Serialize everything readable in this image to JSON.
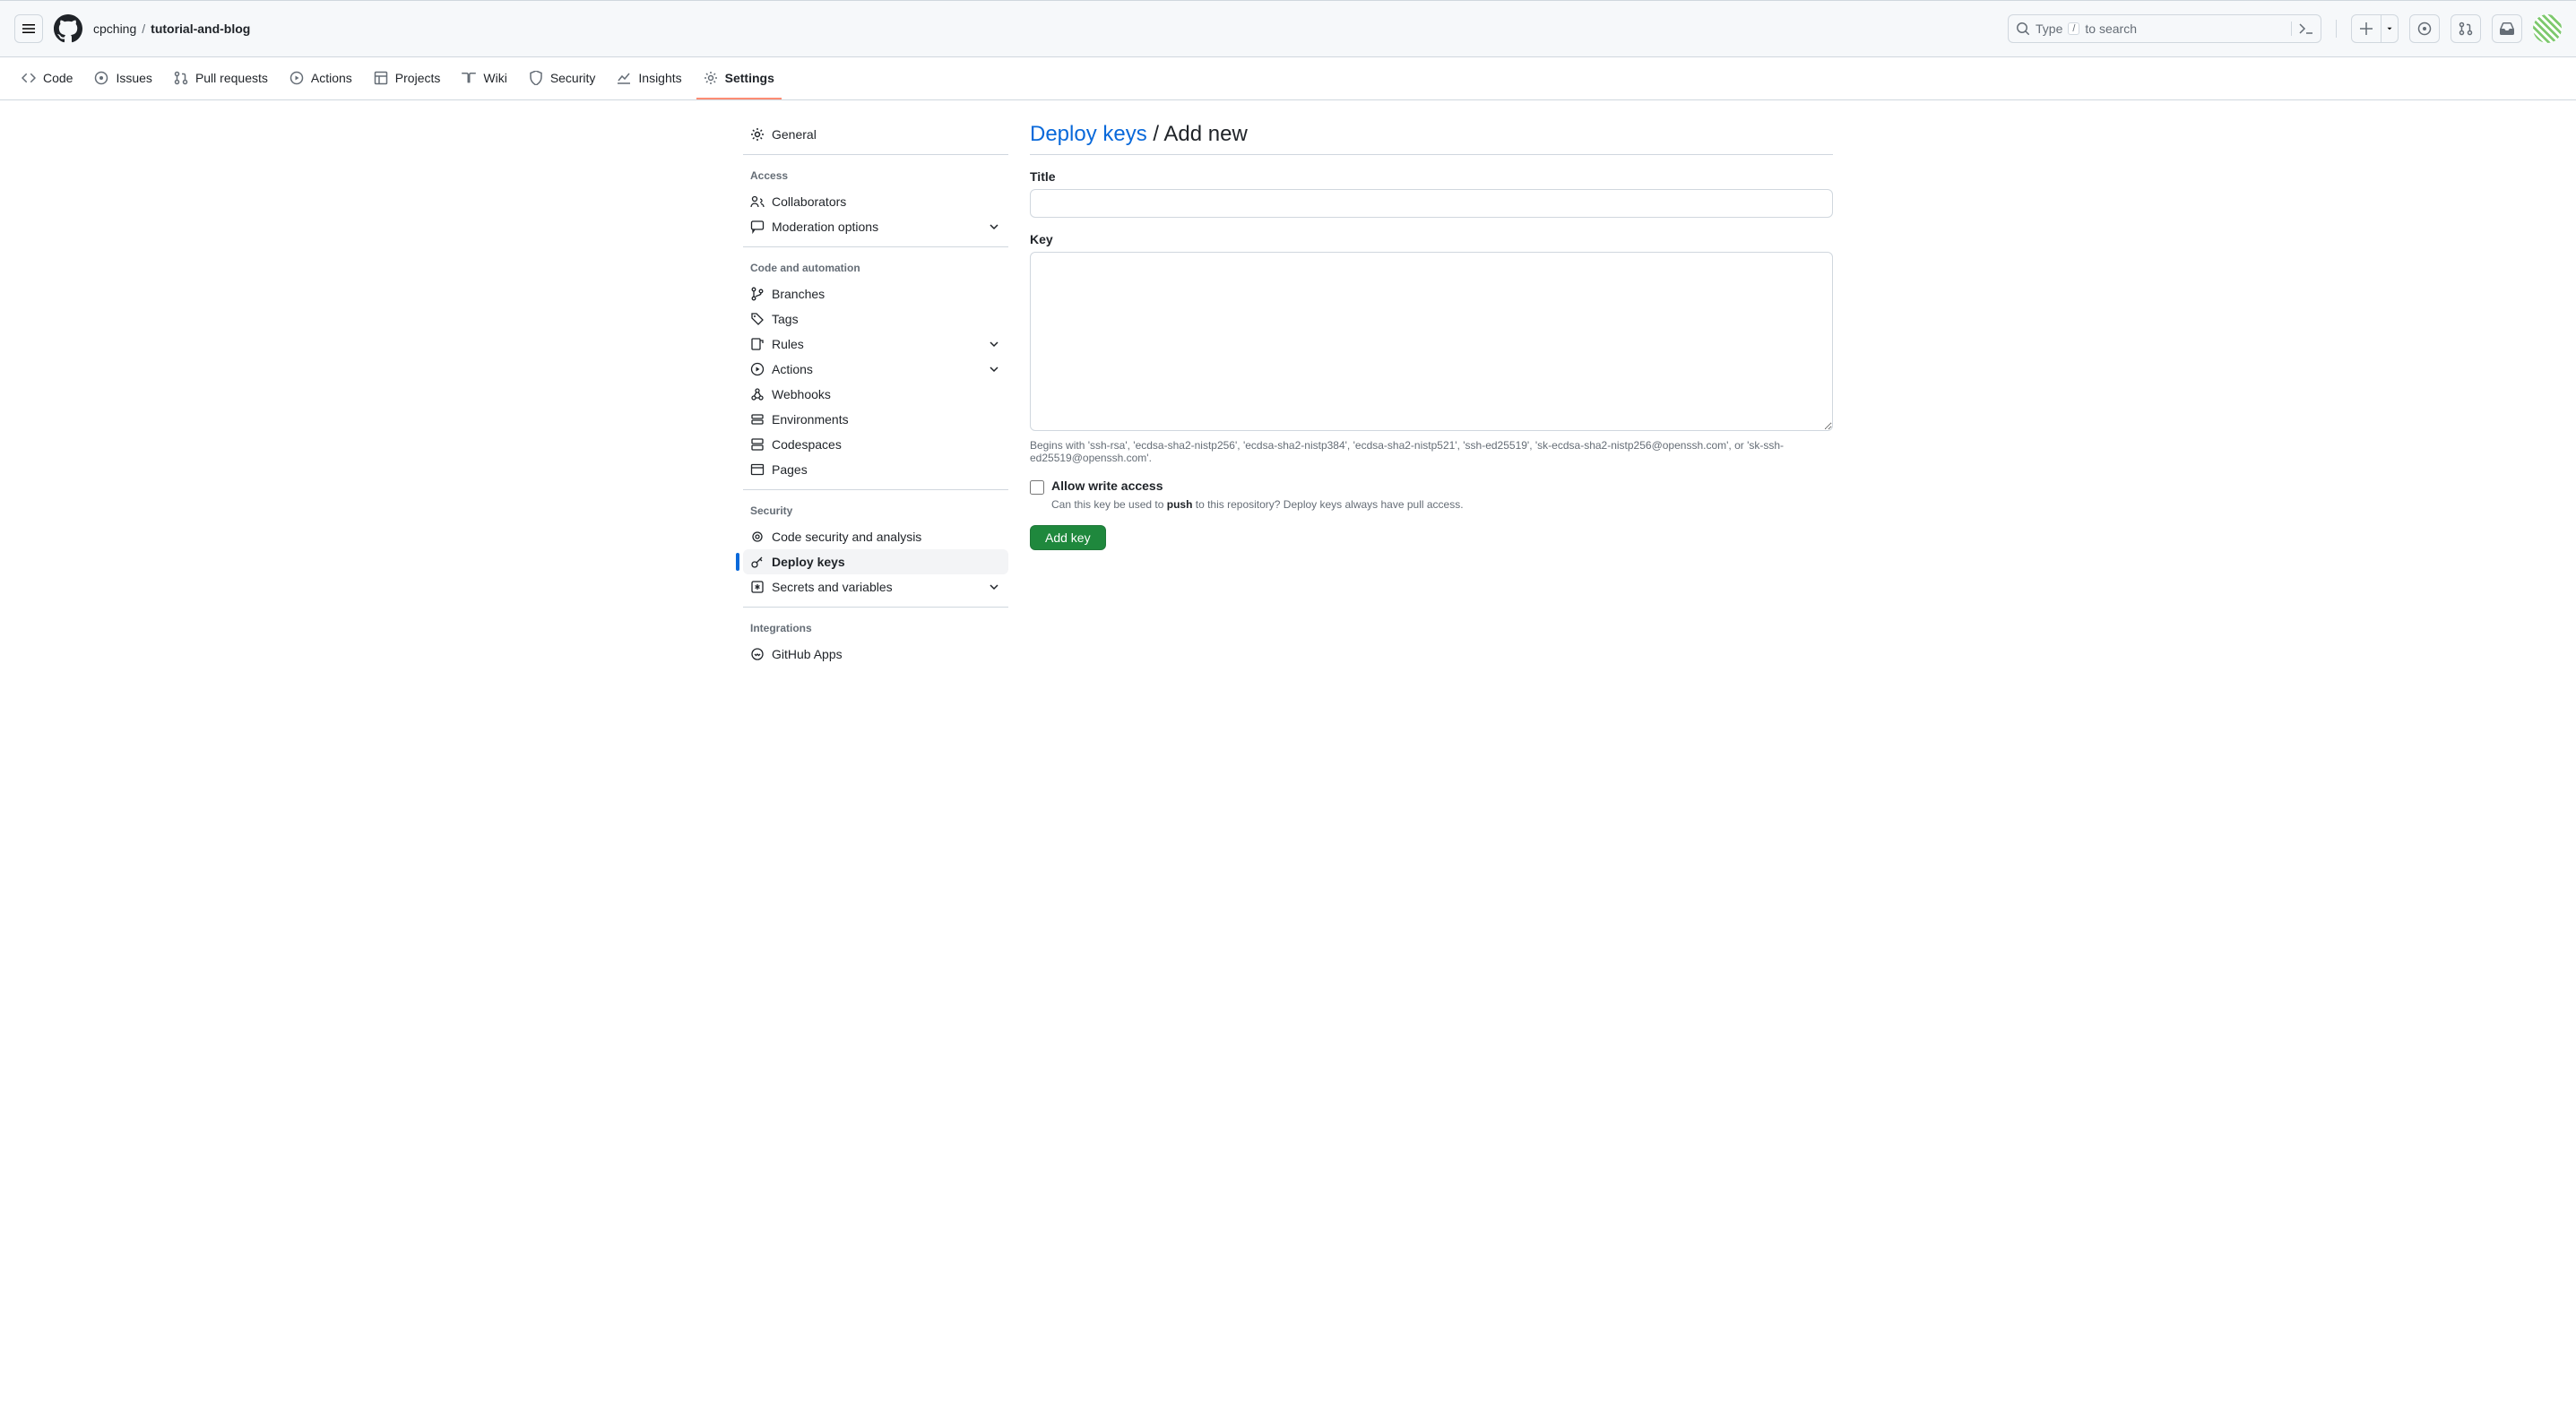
{
  "header": {
    "owner": "cpching",
    "repo": "tutorial-and-blog",
    "search_hint_pre": "Type",
    "search_key": "/",
    "search_hint_post": "to search"
  },
  "nav": {
    "code": "Code",
    "issues": "Issues",
    "pulls": "Pull requests",
    "actions": "Actions",
    "projects": "Projects",
    "wiki": "Wiki",
    "security": "Security",
    "insights": "Insights",
    "settings": "Settings"
  },
  "sidebar": {
    "general": "General",
    "section_access": "Access",
    "collaborators": "Collaborators",
    "moderation": "Moderation options",
    "section_code": "Code and automation",
    "branches": "Branches",
    "tags": "Tags",
    "rules": "Rules",
    "actions": "Actions",
    "webhooks": "Webhooks",
    "environments": "Environments",
    "codespaces": "Codespaces",
    "pages": "Pages",
    "section_security": "Security",
    "code_security": "Code security and analysis",
    "deploy_keys": "Deploy keys",
    "secrets": "Secrets and variables",
    "section_integrations": "Integrations",
    "github_apps": "GitHub Apps"
  },
  "page": {
    "title_link": "Deploy keys",
    "title_sep": " / ",
    "title_sub": "Add new",
    "title_label": "Title",
    "key_label": "Key",
    "key_hint": "Begins with 'ssh-rsa', 'ecdsa-sha2-nistp256', 'ecdsa-sha2-nistp384', 'ecdsa-sha2-nistp521', 'ssh-ed25519', 'sk-ecdsa-sha2-nistp256@openssh.com', or 'sk-ssh-ed25519@openssh.com'.",
    "allow_write_label": "Allow write access",
    "allow_write_desc_pre": "Can this key be used to ",
    "allow_write_desc_bold": "push",
    "allow_write_desc_post": " to this repository? Deploy keys always have pull access.",
    "submit": "Add key"
  }
}
